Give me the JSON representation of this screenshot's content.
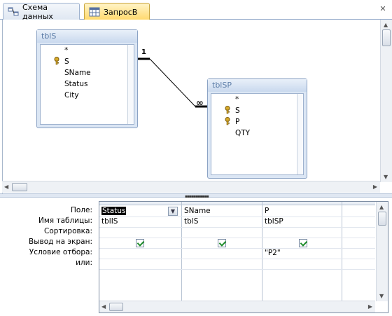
{
  "tabs": [
    {
      "label": "Схема данных",
      "icon": "relationships-icon"
    },
    {
      "label": "ЗапросВ",
      "icon": "query-icon"
    }
  ],
  "tab_close_glyph": "✕",
  "tables": [
    {
      "title": "tblS",
      "fields": [
        "*",
        "S",
        "SName",
        "Status",
        "City"
      ],
      "key_fields": [
        "S"
      ]
    },
    {
      "title": "tblSP",
      "fields": [
        "*",
        "S",
        "P",
        "QTY"
      ],
      "key_fields": [
        "S",
        "P"
      ]
    }
  ],
  "relationship": {
    "one_label": "1",
    "many_label": "∞"
  },
  "row_labels": [
    "Поле:",
    "Имя таблицы:",
    "Сортировка:",
    "Вывод на экран:",
    "Условие отбора:",
    "или:"
  ],
  "columns": [
    {
      "field": "Status",
      "table": "tblIS",
      "sort": "",
      "show": true,
      "criteria": "",
      "or": ""
    },
    {
      "field": "SName",
      "table": "tblS",
      "sort": "",
      "show": true,
      "criteria": "",
      "or": ""
    },
    {
      "field": "P",
      "table": "tblSP",
      "sort": "",
      "show": true,
      "criteria": "\"P2\"",
      "or": ""
    }
  ],
  "colors": {
    "accent": "#ffd86a",
    "frame": "#8aa2c4",
    "check": "#1e8c2a"
  }
}
